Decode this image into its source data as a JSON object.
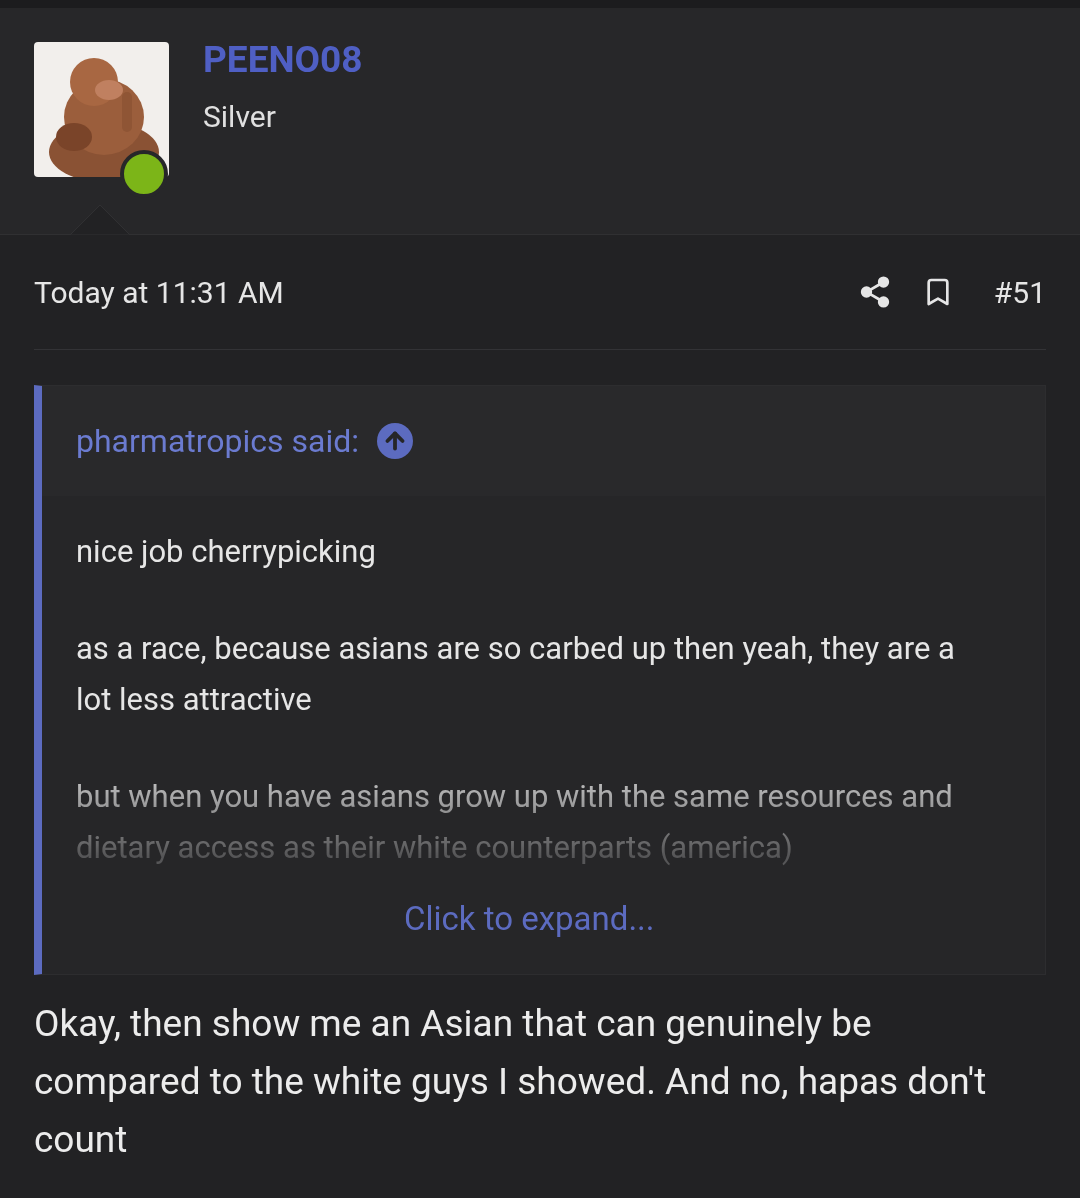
{
  "post": {
    "author": {
      "name": "PEENO08",
      "rank": "Silver",
      "online": true
    },
    "time": "Today at 11:31 AM",
    "number": "#51",
    "quote": {
      "attribution": "pharmatropics said:",
      "paragraphs": [
        "nice job cherrypicking",
        "as a race, because asians are so carbed up then yeah, they are a lot less attractive",
        "but when you have asians grow up with the same resources and dietary access as their white counterparts (america)"
      ],
      "expand": "Click to expand..."
    },
    "body": "Okay, then show me an Asian that can genuinely be compared to the white guys I showed. And no, hapas don't count"
  }
}
